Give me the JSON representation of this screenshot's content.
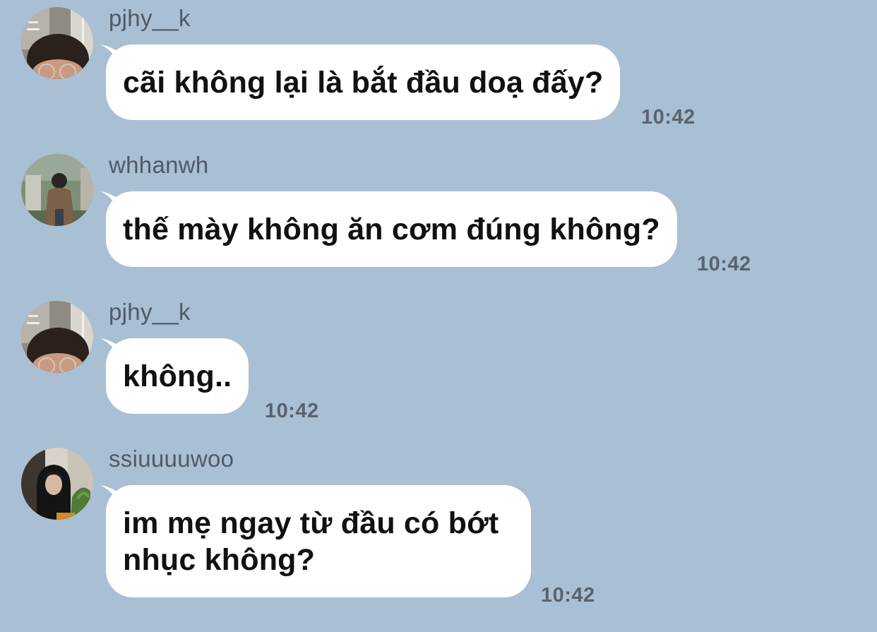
{
  "messages": [
    {
      "sender": "pjhy__k",
      "avatar_icon": "profile-photo-boy-glasses",
      "text": "cãi không lại là bắt đầu doạ đấy?",
      "time": "10:42"
    },
    {
      "sender": "whhanwh",
      "avatar_icon": "profile-photo-outdoor-street",
      "text": "thế mày không ăn cơm đúng không?",
      "time": "10:42"
    },
    {
      "sender": "pjhy__k",
      "avatar_icon": "profile-photo-boy-glasses",
      "text": "không..",
      "time": "10:42"
    },
    {
      "sender": "ssiuuuuwoo",
      "avatar_icon": "profile-photo-hooded-person",
      "text": "im mẹ ngay từ đầu có bớt nhục không?",
      "time": "10:42"
    }
  ],
  "colors": {
    "background": "#a9bfd3",
    "bubble": "#ffffff",
    "sender_text": "#4f5a66",
    "time_text": "#59636e",
    "message_text": "#111111"
  }
}
